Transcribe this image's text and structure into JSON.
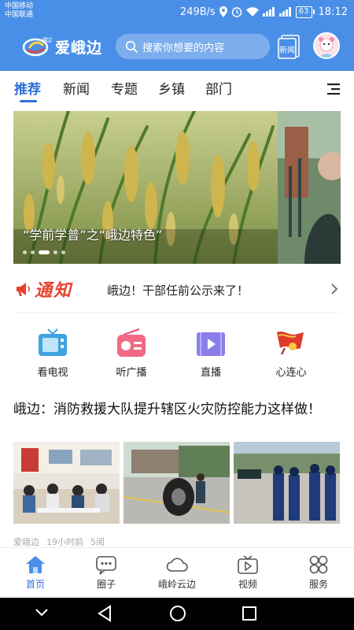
{
  "status_bar": {
    "carrier_1": "中国移动",
    "carrier_2": "中国联通",
    "net_speed": "249B/s",
    "battery": "63",
    "time": "18:12"
  },
  "header": {
    "logo_badge": "峨边",
    "logo_text": "爱峨边",
    "search_placeholder": "搜索你想要的内容",
    "news_icon_text": "新闻"
  },
  "tabs": [
    {
      "label": "推荐",
      "active": true
    },
    {
      "label": "新闻",
      "active": false
    },
    {
      "label": "专题",
      "active": false
    },
    {
      "label": "乡镇",
      "active": false
    },
    {
      "label": "部门",
      "active": false
    }
  ],
  "banner": {
    "caption": "“学前学普”之“峨边特色”",
    "slide_count": 5,
    "active_slide": 3
  },
  "notice": {
    "tag": "通知",
    "text": "峨边！干部任前公示来了！"
  },
  "quick_entries": [
    {
      "label": "看电视",
      "icon": "tv-icon"
    },
    {
      "label": "听广播",
      "icon": "radio-icon"
    },
    {
      "label": "直播",
      "icon": "live-video-icon"
    },
    {
      "label": "心连心",
      "icon": "red-flag-icon"
    }
  ],
  "article": {
    "title": "峨边：消防救援大队提升辖区火灾防控能力这样做！",
    "source": "爱峨边",
    "time": "19小时前",
    "reads": "5阅"
  },
  "bottom_nav": [
    {
      "label": "首页",
      "icon": "home-icon",
      "active": true
    },
    {
      "label": "圈子",
      "icon": "chat-bubble-icon",
      "active": false
    },
    {
      "label": "峨岭云边",
      "icon": "cloud-icon",
      "active": false
    },
    {
      "label": "视频",
      "icon": "video-icon",
      "active": false
    },
    {
      "label": "服务",
      "icon": "grid-icon",
      "active": false
    }
  ],
  "colors": {
    "header_blue": "#4a8fe7",
    "active_blue": "#2f6fd8",
    "notice_red": "#e8412f"
  }
}
